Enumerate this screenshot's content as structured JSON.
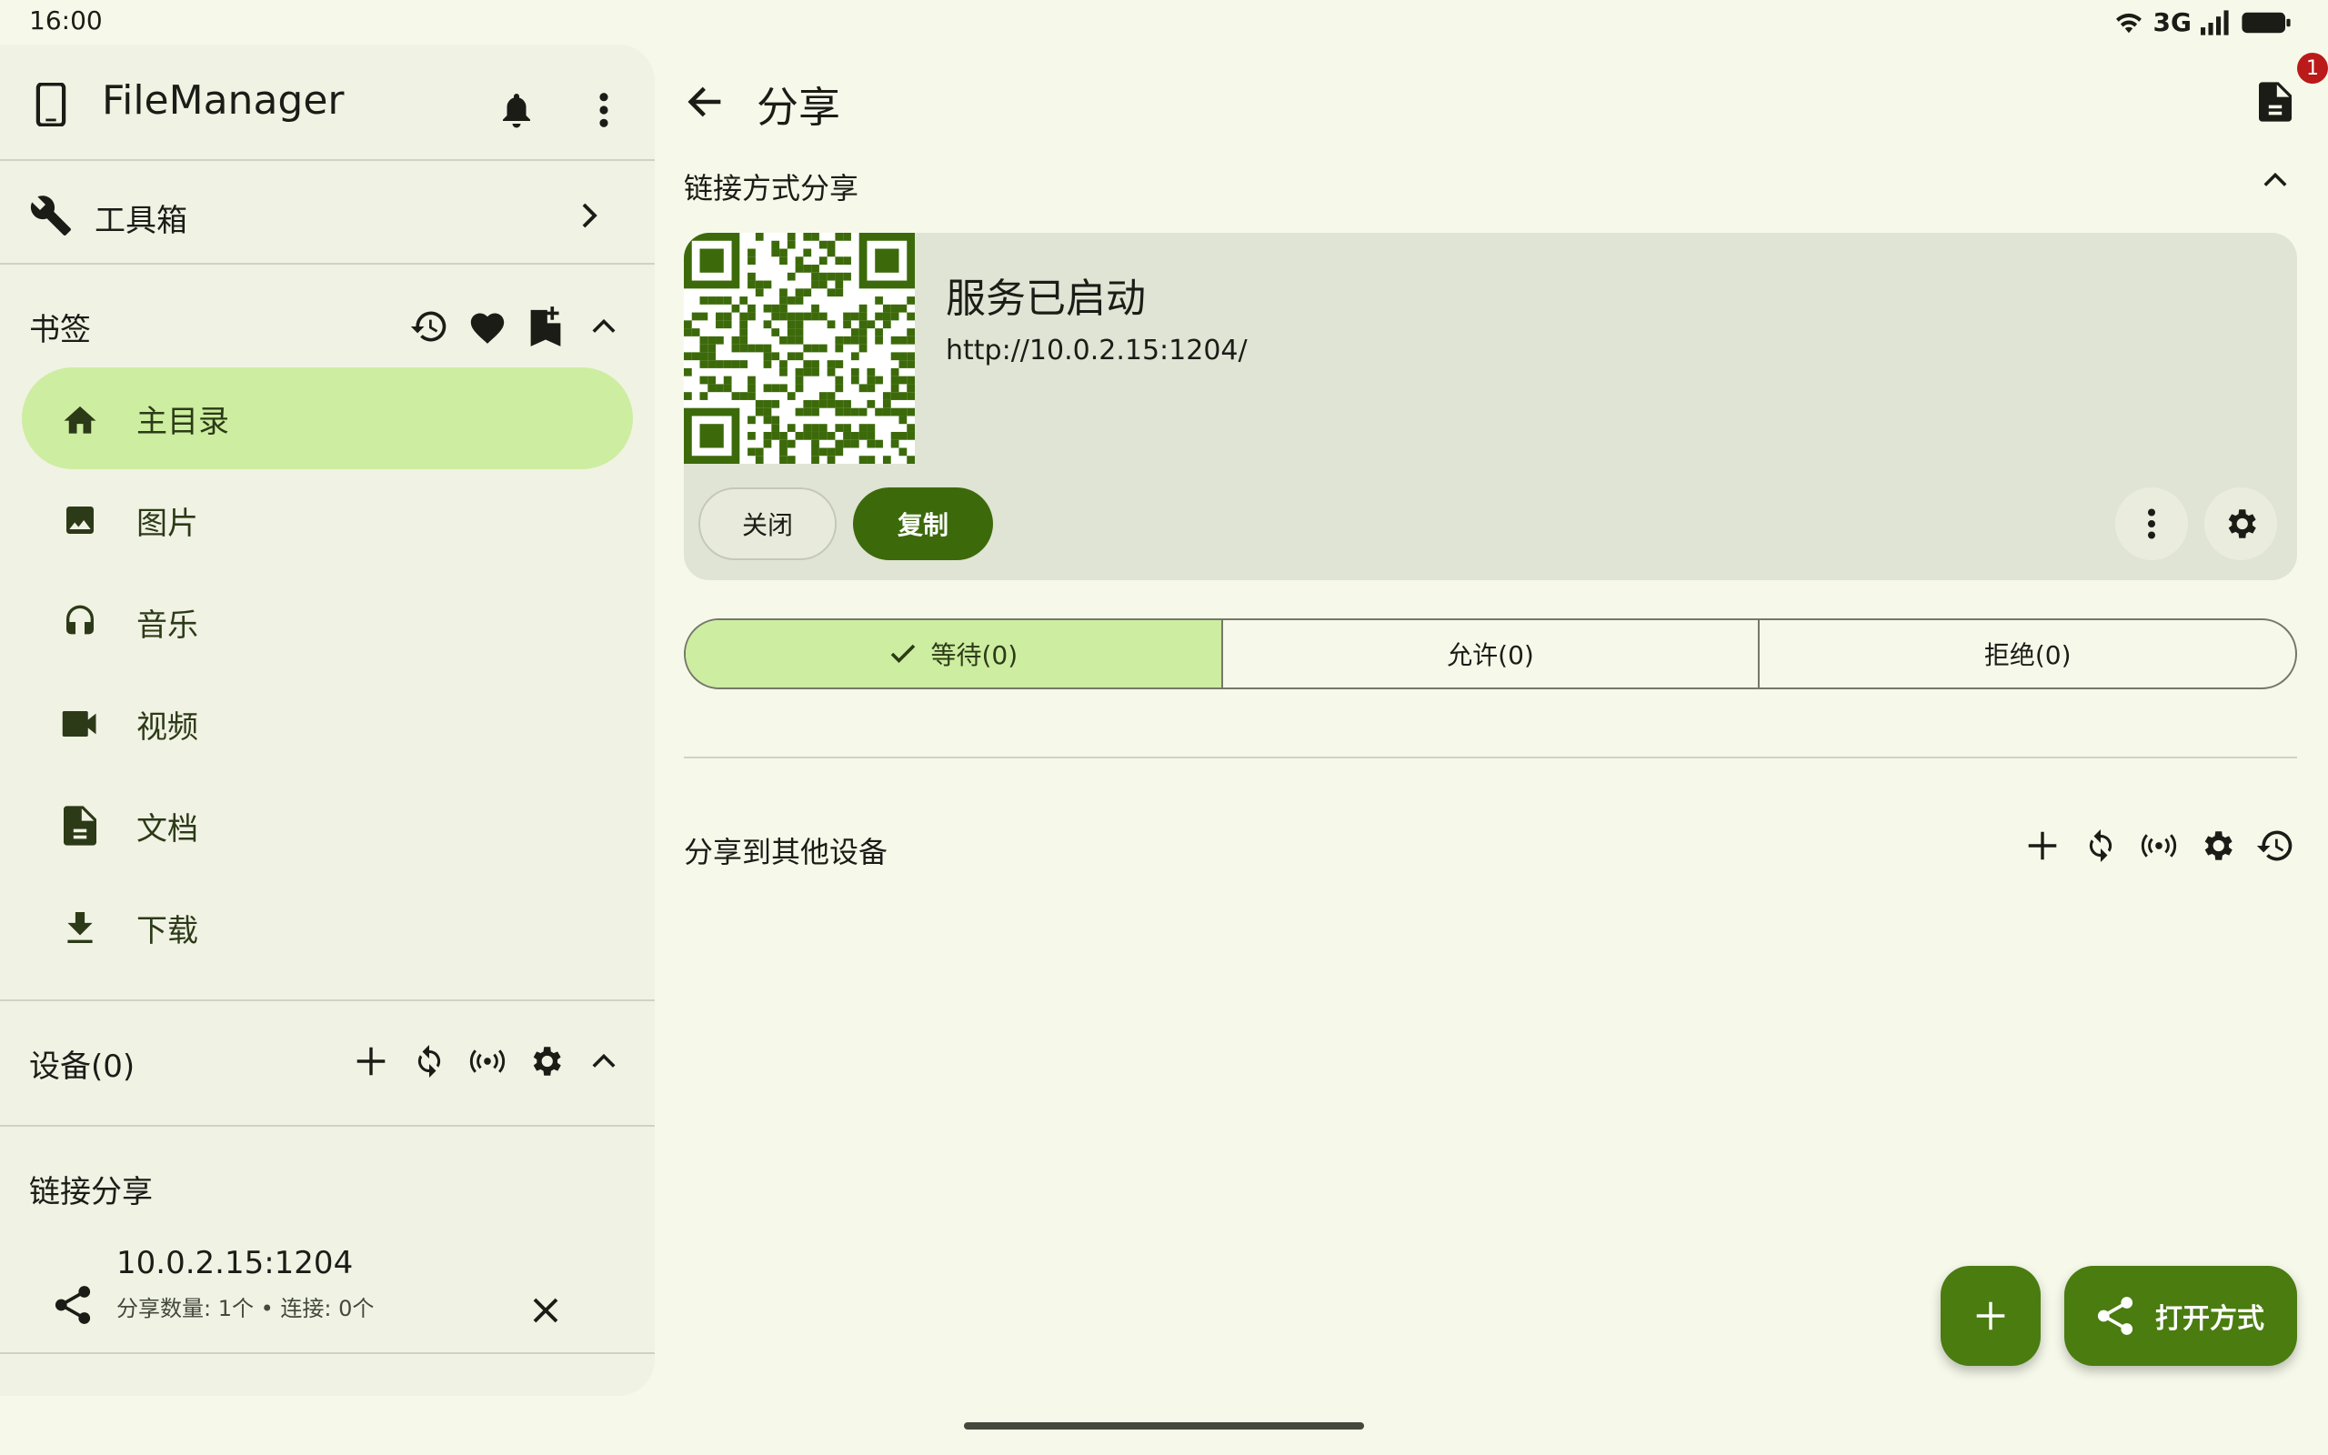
{
  "status": {
    "time": "16:00",
    "network": "3G"
  },
  "sidebar": {
    "app_title": "FileManager",
    "toolbox_label": "工具箱",
    "bookmarks_label": "书签",
    "nav": [
      {
        "label": "主目录",
        "icon": "home-icon"
      },
      {
        "label": "图片",
        "icon": "image-icon"
      },
      {
        "label": "音乐",
        "icon": "headphones-icon"
      },
      {
        "label": "视频",
        "icon": "video-icon"
      },
      {
        "label": "文档",
        "icon": "document-icon"
      },
      {
        "label": "下载",
        "icon": "download-icon"
      }
    ],
    "devices_label": "设备(0)",
    "link_share_label": "链接分享",
    "link_share_item": {
      "address": "10.0.2.15:1204",
      "detail": "分享数量: 1个 • 连接: 0个"
    }
  },
  "main": {
    "title": "分享",
    "badge_count": "1",
    "link_section_label": "链接方式分享",
    "card": {
      "status": "服务已启动",
      "url": "http://10.0.2.15:1204/",
      "close_label": "关闭",
      "copy_label": "复制"
    },
    "tabs": [
      {
        "label": "等待(0)",
        "selected": true
      },
      {
        "label": "允许(0)",
        "selected": false
      },
      {
        "label": "拒绝(0)",
        "selected": false
      }
    ],
    "other_devices_label": "分享到其他设备",
    "fab_open_with": "打开方式"
  },
  "colors": {
    "accent": "#4a7c10",
    "selected": "#cdeda0",
    "background": "#f6f9ea"
  }
}
